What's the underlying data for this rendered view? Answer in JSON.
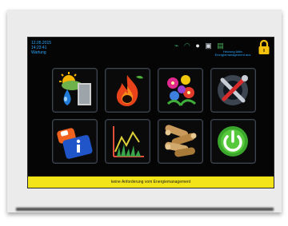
{
  "status": {
    "left_lines": [
      "12.05.2015",
      "14:23:41",
      "Wartung"
    ],
    "right_text": "Heizung Aktiv Energiemanagement aus",
    "icons": [
      "network-icon",
      "wifi-icon",
      "status-dot-icon",
      "monitor-icon",
      "energy-icon",
      "lock-icon"
    ]
  },
  "tiles": [
    {
      "name": "weather-sun-rain-door-icon"
    },
    {
      "name": "flame-icon"
    },
    {
      "name": "flowers-icon"
    },
    {
      "name": "tools-wrench-icon"
    },
    {
      "name": "info-document-icon"
    },
    {
      "name": "chart-grass-icon"
    },
    {
      "name": "wood-logs-icon"
    },
    {
      "name": "power-button-icon"
    }
  ],
  "banner": {
    "text": "keine Anforderung vom Energiemanagement"
  },
  "colors": {
    "screen_bg": "#050505",
    "banner_bg": "#f3e41a",
    "status_text": "#2ba7ff",
    "lock": "#f4c20d"
  }
}
